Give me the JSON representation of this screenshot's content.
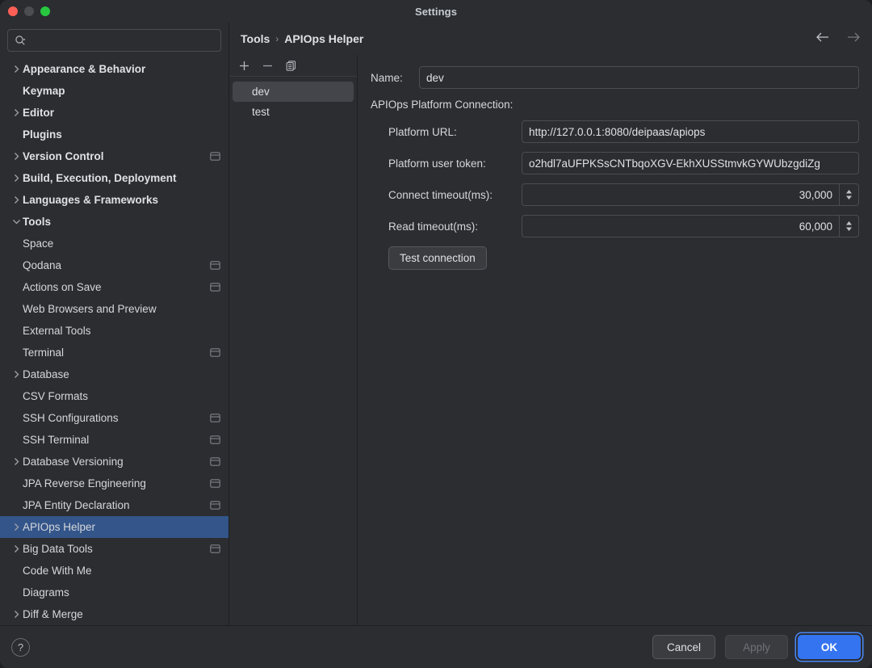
{
  "window": {
    "title": "Settings"
  },
  "search": {
    "value": "",
    "placeholder": ""
  },
  "sidebar": {
    "items": [
      {
        "label": "Appearance & Behavior",
        "level": 0,
        "arrow": "right",
        "bold": true,
        "badge": false
      },
      {
        "label": "Keymap",
        "level": 0,
        "arrow": "none",
        "bold": true,
        "badge": false
      },
      {
        "label": "Editor",
        "level": 0,
        "arrow": "right",
        "bold": true,
        "badge": false
      },
      {
        "label": "Plugins",
        "level": 0,
        "arrow": "none",
        "bold": true,
        "badge": false
      },
      {
        "label": "Version Control",
        "level": 0,
        "arrow": "right",
        "bold": true,
        "badge": true
      },
      {
        "label": "Build, Execution, Deployment",
        "level": 0,
        "arrow": "right",
        "bold": true,
        "badge": false
      },
      {
        "label": "Languages & Frameworks",
        "level": 0,
        "arrow": "right",
        "bold": true,
        "badge": false
      },
      {
        "label": "Tools",
        "level": 0,
        "arrow": "down",
        "bold": true,
        "badge": false
      },
      {
        "label": "Space",
        "level": 1,
        "arrow": "none",
        "bold": false,
        "badge": false
      },
      {
        "label": "Qodana",
        "level": 1,
        "arrow": "none",
        "bold": false,
        "badge": true
      },
      {
        "label": "Actions on Save",
        "level": 1,
        "arrow": "none",
        "bold": false,
        "badge": true
      },
      {
        "label": "Web Browsers and Preview",
        "level": 1,
        "arrow": "none",
        "bold": false,
        "badge": false
      },
      {
        "label": "External Tools",
        "level": 1,
        "arrow": "none",
        "bold": false,
        "badge": false
      },
      {
        "label": "Terminal",
        "level": 1,
        "arrow": "none",
        "bold": false,
        "badge": true
      },
      {
        "label": "Database",
        "level": 1,
        "arrow": "right",
        "bold": false,
        "badge": false
      },
      {
        "label": "CSV Formats",
        "level": 1,
        "arrow": "none",
        "bold": false,
        "badge": false
      },
      {
        "label": "SSH Configurations",
        "level": 1,
        "arrow": "none",
        "bold": false,
        "badge": true
      },
      {
        "label": "SSH Terminal",
        "level": 1,
        "arrow": "none",
        "bold": false,
        "badge": true
      },
      {
        "label": "Database Versioning",
        "level": 1,
        "arrow": "right",
        "bold": false,
        "badge": true
      },
      {
        "label": "JPA Reverse Engineering",
        "level": 1,
        "arrow": "none",
        "bold": false,
        "badge": true
      },
      {
        "label": "JPA Entity Declaration",
        "level": 1,
        "arrow": "none",
        "bold": false,
        "badge": true
      },
      {
        "label": "APIOps Helper",
        "level": 1,
        "arrow": "right",
        "bold": false,
        "badge": false,
        "selected": true
      },
      {
        "label": "Big Data Tools",
        "level": 1,
        "arrow": "right",
        "bold": false,
        "badge": true
      },
      {
        "label": "Code With Me",
        "level": 1,
        "arrow": "none",
        "bold": false,
        "badge": false
      },
      {
        "label": "Diagrams",
        "level": 1,
        "arrow": "none",
        "bold": false,
        "badge": false
      },
      {
        "label": "Diff & Merge",
        "level": 1,
        "arrow": "right",
        "bold": false,
        "badge": false
      }
    ]
  },
  "breadcrumb": {
    "parent": "Tools",
    "separator": "›",
    "current": "APIOps Helper"
  },
  "toolbar": {
    "add": "+",
    "remove": "−",
    "copy": "copy-icon"
  },
  "env_list": {
    "items": [
      {
        "label": "dev",
        "selected": true
      },
      {
        "label": "test",
        "selected": false
      }
    ]
  },
  "form": {
    "name_label": "Name:",
    "name_value": "dev",
    "section_title": "APIOps Platform Connection:",
    "platform_url_label": "Platform URL:",
    "platform_url_value": "http://127.0.0.1:8080/deipaas/apiops",
    "token_label": "Platform user token:",
    "token_value": "o2hdl7aUFPKSsCNTbqoXGV-EkhXUSStmvkGYWUbzgdiZg",
    "connect_timeout_label": "Connect timeout(ms):",
    "connect_timeout_value": "30,000",
    "read_timeout_label": "Read timeout(ms):",
    "read_timeout_value": "60,000",
    "test_button": "Test connection"
  },
  "footer": {
    "help": "?",
    "cancel": "Cancel",
    "apply": "Apply",
    "ok": "OK"
  },
  "colors": {
    "accent": "#3574f0",
    "selection": "#33558a",
    "background": "#2b2d30",
    "border": "#4a4d51"
  }
}
